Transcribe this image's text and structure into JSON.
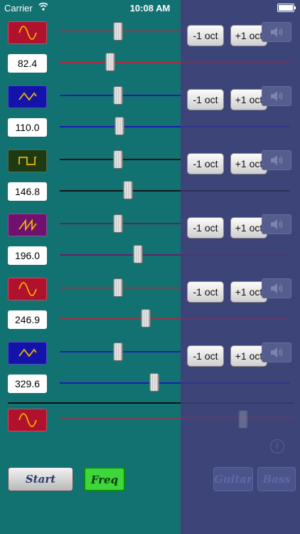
{
  "status": {
    "carrier": "Carrier",
    "time": "10:08 AM"
  },
  "voices": [
    {
      "waveform": "sine-wave-icon",
      "color": "#b0112c",
      "frequency": "82.4",
      "track_color": "#aa2b40",
      "oct_down": "-1 oct",
      "oct_up": "+1 oct"
    },
    {
      "waveform": "triangle-wave-icon",
      "color": "#1313aa",
      "frequency": "110.0",
      "track_color": "#1c1cb5",
      "oct_down": "-1 oct",
      "oct_up": "+1 oct"
    },
    {
      "waveform": "square-wave-icon",
      "color": "#1d3a12",
      "frequency": "146.8",
      "track_color": "#141414",
      "oct_down": "-1 oct",
      "oct_up": "+1 oct"
    },
    {
      "waveform": "sawtooth-wave-icon",
      "color": "#6e126e",
      "frequency": "196.0",
      "track_color": "#5e2466",
      "oct_down": "-1 oct",
      "oct_up": "+1 oct"
    },
    {
      "waveform": "sine-wave-icon",
      "color": "#b0112c",
      "frequency": "246.9",
      "track_color": "#aa2b40",
      "oct_down": "-1 oct",
      "oct_up": "+1 oct"
    },
    {
      "waveform": "triangle-wave-icon",
      "color": "#1313aa",
      "frequency": "329.6",
      "track_color": "#1c1cb5",
      "oct_down": "-1 oct",
      "oct_up": "+1 oct"
    }
  ],
  "master": {
    "waveform": "sine-wave-icon",
    "color": "#b0112c",
    "track_color": "#aa2b40"
  },
  "controls": {
    "start_label": "Start",
    "freq_label": "Freq",
    "guitar_label": "Guitar",
    "bass_label": "Bass",
    "info_glyph": "i"
  },
  "icons": {
    "speaker": "speaker-icon",
    "info": "info-icon"
  }
}
